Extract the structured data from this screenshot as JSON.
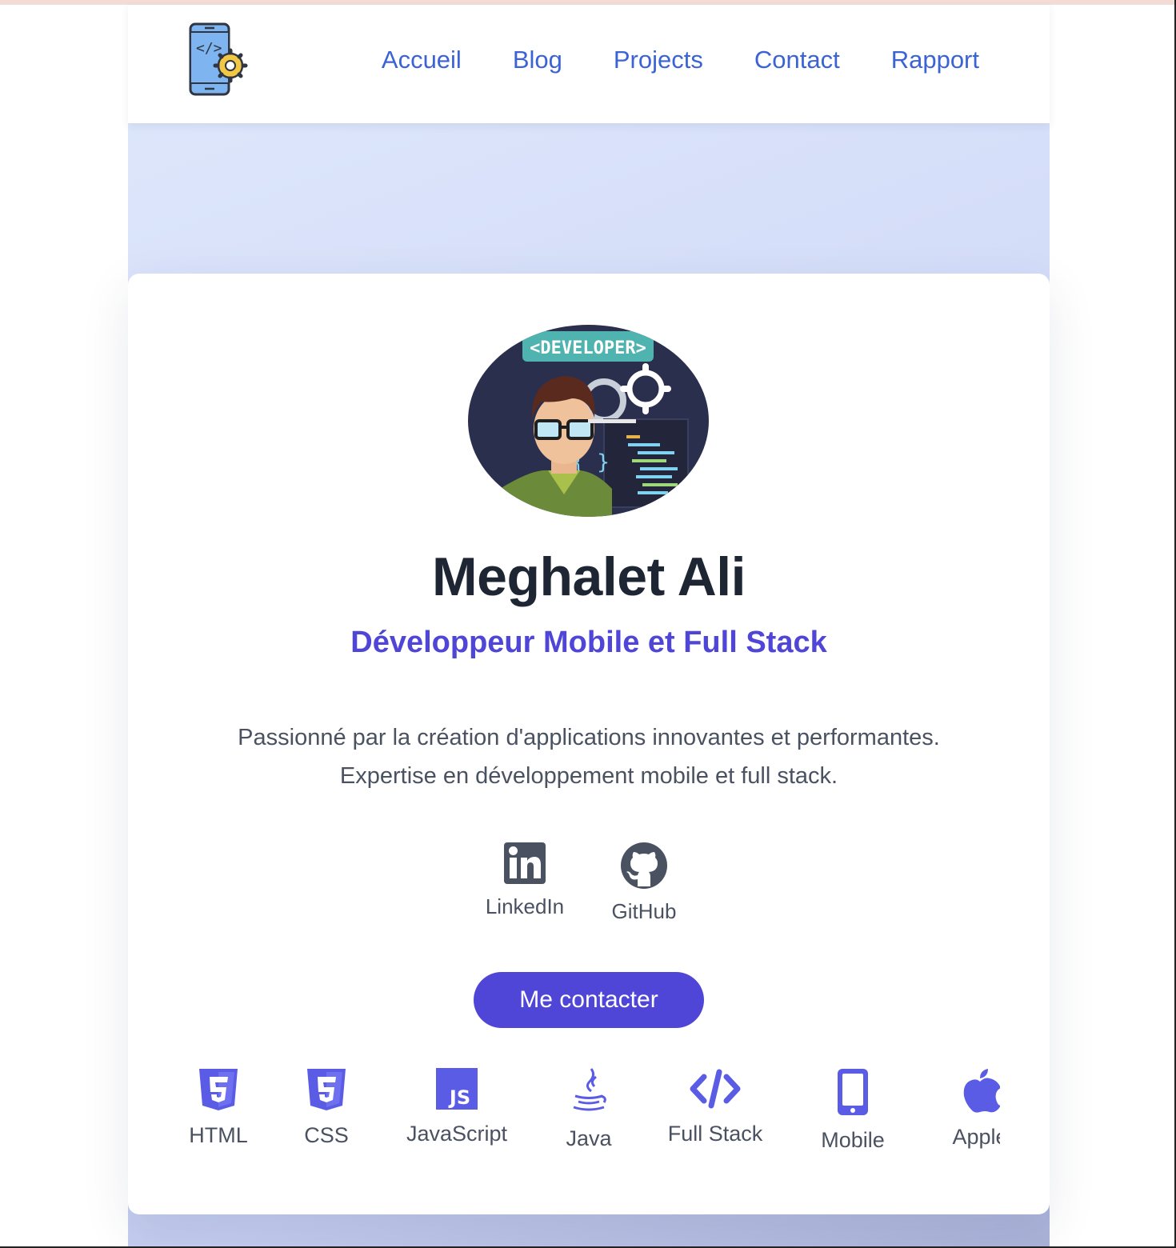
{
  "nav": {
    "logo_icon": "mobile-dev-gear-icon",
    "links": [
      "Accueil",
      "Blog",
      "Projects",
      "Contact",
      "Rapport"
    ]
  },
  "profile": {
    "avatar_banner": "<DEVELOPER>",
    "name": "Meghalet Ali",
    "title": "Développeur Mobile et Full Stack",
    "bio_line1": "Passionné par la création d'applications innovantes et performantes.",
    "bio_line2": "Expertise en développement mobile et full stack."
  },
  "socials": [
    {
      "label": "LinkedIn",
      "icon": "linkedin-icon"
    },
    {
      "label": "GitHub",
      "icon": "github-icon"
    }
  ],
  "cta": {
    "label": "Me contacter"
  },
  "skills": [
    {
      "label": "HTML",
      "icon": "html5-icon"
    },
    {
      "label": "CSS",
      "icon": "css3-icon"
    },
    {
      "label": "JavaScript",
      "icon": "js-icon"
    },
    {
      "label": "Java",
      "icon": "java-icon"
    },
    {
      "label": "Full Stack",
      "icon": "code-icon"
    },
    {
      "label": "Mobile",
      "icon": "mobile-icon"
    },
    {
      "label": "Apple",
      "icon": "apple-icon"
    }
  ],
  "colors": {
    "accent": "#4f46d8",
    "nav_link": "#3b63d6",
    "heading": "#1e2533",
    "body_text": "#4a5262",
    "skill_icon": "#5b5ce6"
  }
}
